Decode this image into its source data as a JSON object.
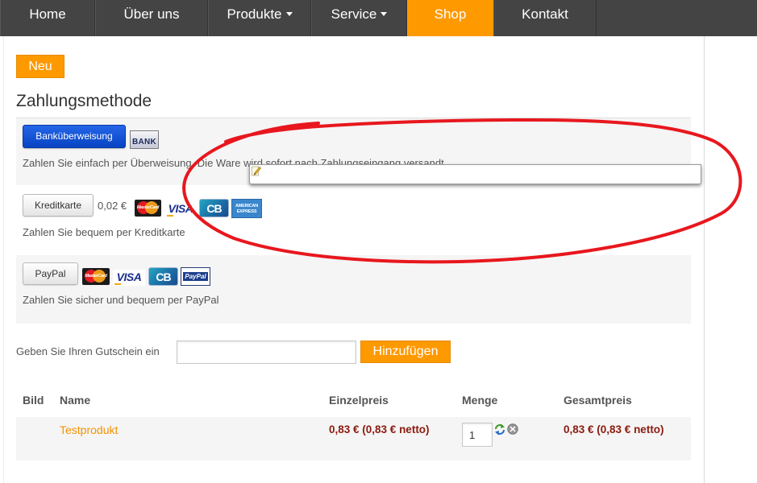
{
  "nav": {
    "items": [
      {
        "label": "Home",
        "dropdown": false,
        "active": false
      },
      {
        "label": "Über uns",
        "dropdown": false,
        "active": false
      },
      {
        "label": "Produkte",
        "dropdown": true,
        "active": false
      },
      {
        "label": "Service",
        "dropdown": true,
        "active": false
      },
      {
        "label": "Shop",
        "dropdown": false,
        "active": true
      },
      {
        "label": "Kontakt",
        "dropdown": false,
        "active": false
      }
    ]
  },
  "new_button": {
    "label": "Neu"
  },
  "payment": {
    "title": "Zahlungsmethode",
    "methods": [
      {
        "button": "Banküberweisung",
        "selected": true,
        "logos": [
          "BANK"
        ],
        "description": "Zahlen Sie einfach per Überweisung. Die Ware wird sofort nach Zahlungseingang versandt."
      },
      {
        "button": "Kreditkarte",
        "selected": false,
        "fee": "0,02 €",
        "logos": [
          "MasterCard",
          "VISA",
          "CB",
          "AMERICAN EXPRESS"
        ],
        "description": "Zahlen Sie bequem per Kreditkarte"
      },
      {
        "button": "PayPal",
        "selected": false,
        "logos": [
          "MasterCard",
          "VISA",
          "CB",
          "PayPal"
        ],
        "description": "Zahlen Sie sicher und bequem per PayPal"
      }
    ]
  },
  "coupon": {
    "label": "Geben Sie Ihren Gutschein ein",
    "value": "",
    "button": "Hinzufügen"
  },
  "cart": {
    "headers": {
      "image": "Bild",
      "name": "Name",
      "unit_price": "Einzelpreis",
      "quantity": "Menge",
      "total": "Gesamtpreis"
    },
    "rows": [
      {
        "name": "Testprodukt",
        "unit_price": "0,83 € (0,83 € netto)",
        "quantity": "1",
        "total": "0,83 € (0,83 € netto)"
      }
    ]
  },
  "icons": {
    "dropdown": "chevron-down-icon",
    "pencil": "pencil-icon",
    "refresh": "refresh-icon",
    "remove": "remove-icon"
  },
  "colors": {
    "nav_bg": "#444444",
    "accent": "#ff9900",
    "primary": "#0b4fd6",
    "price": "#8c1a0e",
    "link": "#f39200",
    "annotation": "#e8171e",
    "row_bg": "#f5f5f5"
  }
}
